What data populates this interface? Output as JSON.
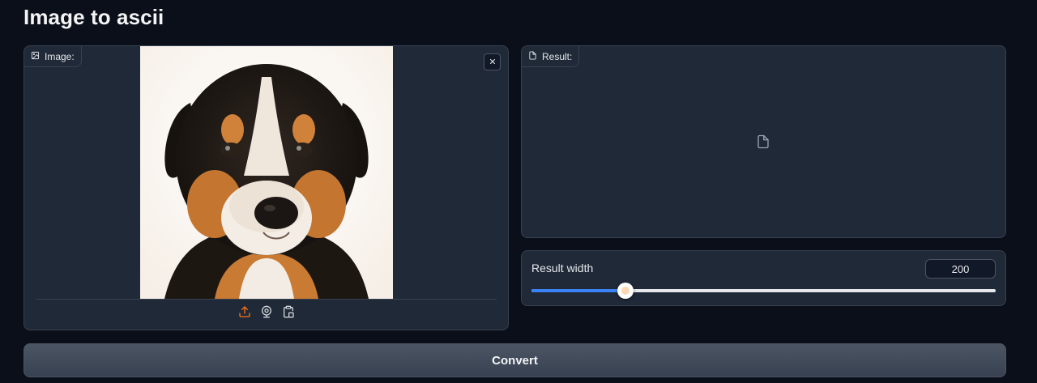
{
  "app": {
    "title": "Image to ascii"
  },
  "image_input": {
    "label": "Image:",
    "label_icon": "image-icon",
    "clear_icon": "close-icon",
    "sources": [
      "upload-icon",
      "webcam-icon",
      "clipboard-icon"
    ]
  },
  "result": {
    "label": "Result:",
    "label_icon": "file-icon",
    "empty_icon": "file-icon"
  },
  "slider": {
    "label": "Result width",
    "value": "200",
    "fraction": 0.203
  },
  "actions": {
    "convert_label": "Convert"
  },
  "colors": {
    "background": "#0b0f19",
    "panel": "#1f2937",
    "accent_blue": "#3b82f6",
    "accent_orange": "#f97316"
  }
}
